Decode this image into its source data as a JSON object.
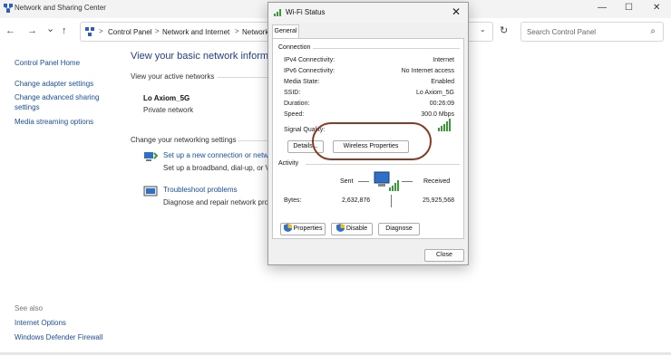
{
  "window": {
    "title": "Network and Sharing Center",
    "controls": {
      "minimize": "—",
      "maximize": "☐",
      "close": "✕"
    }
  },
  "nav": {
    "back": "←",
    "forward": "→",
    "dropdown": "⌄",
    "up": "↑"
  },
  "address": {
    "crumbs": [
      "Control Panel",
      "Network and Internet",
      "Network"
    ],
    "separator": ">",
    "dropdown": "⌄",
    "refresh": "↻"
  },
  "search": {
    "placeholder": "Search Control Panel",
    "icon": "⌕"
  },
  "sidebar": {
    "home": "Control Panel Home",
    "adapter": "Change adapter settings",
    "advanced_1": "Change advanced sharing",
    "advanced_2": "settings",
    "media": "Media streaming options",
    "see_also": "See also",
    "internet_options": "Internet Options",
    "firewall": "Windows Defender Firewall"
  },
  "main": {
    "heading": "View your basic network informa",
    "active_label": "View your active networks",
    "network_name": "Lo Axiom_5G",
    "network_type": "Private network",
    "settings_label": "Change your networking settings",
    "task1_link": "Set up a new connection or netw",
    "task1_desc": "Set up a broadband, dial-up, or V",
    "task2_link": "Troubleshoot problems",
    "task2_desc": "Diagnose and repair network pro"
  },
  "dialog": {
    "title": "Wi-Fi Status",
    "close": "✕",
    "tab": "General",
    "connection_group": "Connection",
    "rows": [
      {
        "label": "IPv4 Connectivity:",
        "value": "Internet"
      },
      {
        "label": "IPv6 Connectivity:",
        "value": "No Internet access"
      },
      {
        "label": "Media State:",
        "value": "Enabled"
      },
      {
        "label": "SSID:",
        "value": "Lo Axiom_5G"
      },
      {
        "label": "Duration:",
        "value": "00:26:09"
      },
      {
        "label": "Speed:",
        "value": "300.0 Mbps"
      }
    ],
    "signal_label": "Signal Quality:",
    "details_btn": "Details...",
    "wireless_btn": "Wireless Properties",
    "activity_group": "Activity",
    "sent_label": "Sent",
    "received_label": "Received",
    "bytes_label": "Bytes:",
    "bytes_sent": "2,632,876",
    "bytes_received": "25,925,568",
    "properties_btn": "Properties",
    "disable_btn": "Disable",
    "diagnose_btn": "Diagnose",
    "close_btn": "Close"
  },
  "colors": {
    "link": "#1a4fa0",
    "heading": "#1e3e8c",
    "signal": "#3a9a3a",
    "highlight_ring": "#8a3a22"
  }
}
